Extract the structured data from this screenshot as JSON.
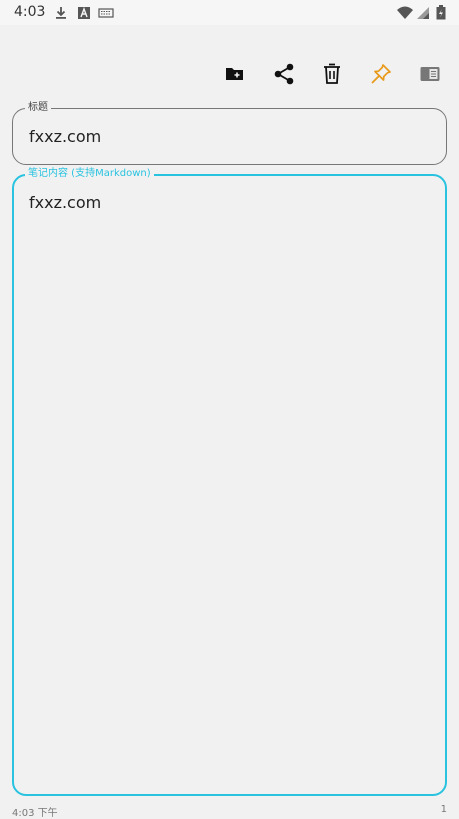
{
  "status_bar": {
    "time": "4:03",
    "icons": [
      "download-icon",
      "font-icon",
      "keyboard-icon",
      "wifi-icon",
      "signal-icon",
      "battery-icon"
    ]
  },
  "toolbar": {
    "icons": [
      "folder-add-icon",
      "share-icon",
      "delete-icon",
      "pin-icon",
      "reader-icon"
    ],
    "pin_color": "#e89a1a"
  },
  "title_field": {
    "label": "标题",
    "value": "fxxz.com"
  },
  "content_field": {
    "label": "笔记内容 (支持Markdown)",
    "value": "fxxz.com",
    "accent": "#29c3e0"
  },
  "footer": {
    "time": "4:03 下午",
    "count": "1"
  }
}
